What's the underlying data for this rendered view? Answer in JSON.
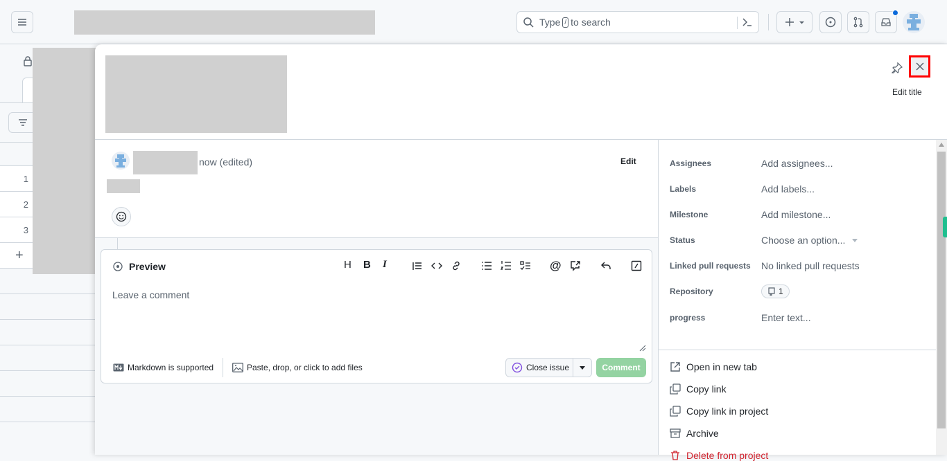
{
  "header": {
    "search_prefix": "Type",
    "search_key": "/",
    "search_suffix": "to search",
    "notification_dot_color": "#0969da"
  },
  "background": {
    "rows": [
      "1",
      "2",
      "3"
    ],
    "add": "+"
  },
  "panel": {
    "edit_title": "Edit title",
    "comment": {
      "timestamp": "now (edited)",
      "edit": "Edit"
    },
    "editor": {
      "preview": "Preview",
      "placeholder": "Leave a comment",
      "markdown": "Markdown is supported",
      "files": "Paste, drop, or click to add files",
      "close_issue": "Close issue",
      "comment": "Comment"
    },
    "fields": [
      {
        "label": "Assignees",
        "value": "Add assignees..."
      },
      {
        "label": "Labels",
        "value": "Add labels..."
      },
      {
        "label": "Milestone",
        "value": "Add milestone..."
      },
      {
        "label": "Status",
        "value": "Choose an option..."
      },
      {
        "label": "Linked pull requests",
        "value": "No linked pull requests"
      },
      {
        "label": "Repository",
        "value": "1"
      },
      {
        "label": "progress",
        "value": "Enter text..."
      }
    ],
    "actions": [
      "Open in new tab",
      "Copy link",
      "Copy link in project",
      "Archive",
      "Delete from project"
    ]
  },
  "colors": {
    "accent_close": "#8250df",
    "comment_btn": "#94d3a2",
    "danger": "#d1242f",
    "highlight": "#ff0000"
  }
}
